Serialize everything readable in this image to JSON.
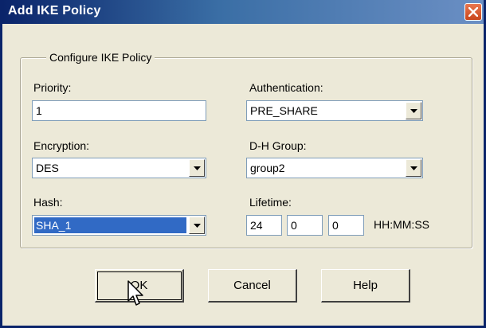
{
  "dialog": {
    "title": "Add IKE Policy",
    "group_title": "Configure IKE Policy"
  },
  "fields": {
    "priority": {
      "label": "Priority:",
      "value": "1"
    },
    "authentication": {
      "label": "Authentication:",
      "value": "PRE_SHARE"
    },
    "encryption": {
      "label": "Encryption:",
      "value": "DES"
    },
    "dh_group": {
      "label": "D-H Group:",
      "value": "group2"
    },
    "hash": {
      "label": "Hash:",
      "value": "SHA_1"
    },
    "lifetime": {
      "label": "Lifetime:",
      "hours": "24",
      "minutes": "0",
      "seconds": "0",
      "format": "HH:MM:SS"
    }
  },
  "buttons": {
    "ok": "OK",
    "cancel": "Cancel",
    "help": "Help"
  },
  "icons": {
    "close": "close-icon",
    "dropdown": "chevron-down-icon",
    "cursor": "mouse-pointer-icon"
  },
  "colors": {
    "title_bar": "#0a246a",
    "close_button": "#c9461c",
    "selection": "#316ac5",
    "dialog_bg": "#ece9d8"
  }
}
